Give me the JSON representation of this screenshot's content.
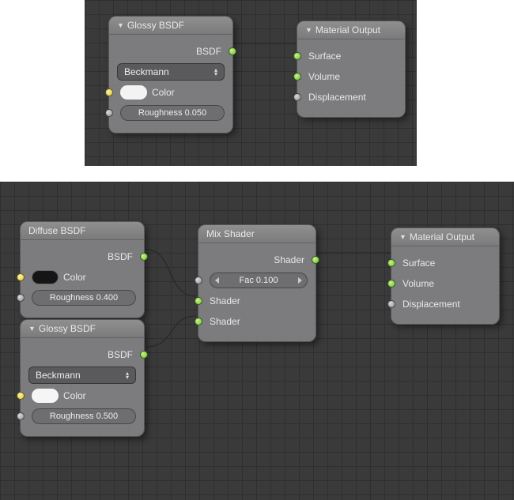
{
  "top": {
    "glossy": {
      "title": "Glossy BSDF",
      "output": "BSDF",
      "dist_select": "Beckmann",
      "color_label": "Color",
      "color_hex": "#f3f3f3",
      "roughness_label": "Roughness 0.050"
    },
    "material_output": {
      "title": "Material Output",
      "surface": "Surface",
      "volume": "Volume",
      "displacement": "Displacement"
    }
  },
  "bottom": {
    "diffuse": {
      "title": "Diffuse BSDF",
      "output": "BSDF",
      "color_label": "Color",
      "color_hex": "#151515",
      "roughness_label": "Roughness 0.400"
    },
    "glossy": {
      "title": "Glossy BSDF",
      "output": "BSDF",
      "dist_select": "Beckmann",
      "color_label": "Color",
      "color_hex": "#f5f5f5",
      "roughness_label": "Roughness 0.500"
    },
    "mix": {
      "title": "Mix Shader",
      "output": "Shader",
      "fac_label": "Fac 0.100",
      "shader1": "Shader",
      "shader2": "Shader"
    },
    "material_output": {
      "title": "Material Output",
      "surface": "Surface",
      "volume": "Volume",
      "displacement": "Displacement"
    }
  }
}
